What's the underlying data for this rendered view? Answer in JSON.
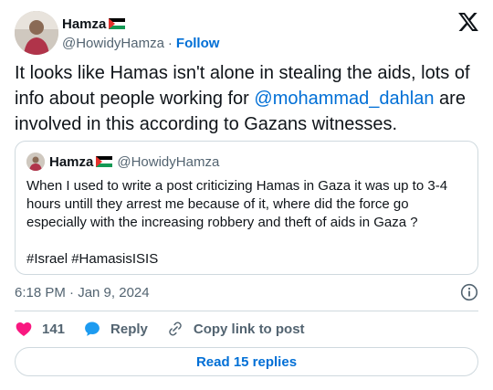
{
  "author": {
    "name": "Hamza",
    "handle": "@HowidyHamza",
    "separator": "·",
    "follow_label": "Follow"
  },
  "tweet": {
    "text_before": "It looks like Hamas isn't alone in stealing the aids, lots of info about people working for ",
    "mention": "@mohammad_dahlan",
    "text_after": " are involved in this according to Gazans witnesses."
  },
  "quote": {
    "name": "Hamza",
    "handle": "@HowidyHamza",
    "text": "When I used to write a post criticizing Hamas in Gaza it was up to 3-4 hours untill they arrest me because of it, where did the force go especially with the increasing robbery and theft of aids in Gaza ?",
    "tags": "#Israel #HamasisISIS"
  },
  "meta": {
    "timestamp": "6:18 PM · Jan 9, 2024"
  },
  "actions": {
    "like_count": "141",
    "reply_label": "Reply",
    "copy_label": "Copy link to post"
  },
  "read_replies_label": "Read 15 replies",
  "icons": {
    "logo": "x-logo-icon",
    "like": "heart-icon",
    "reply": "reply-bubble-icon",
    "copy": "link-icon",
    "info": "info-icon",
    "flag": "palestine-flag-icon"
  },
  "colors": {
    "link": "#006fd6",
    "heart": "#f91880",
    "reply_blue": "#1d9bf0",
    "muted": "#536471",
    "border": "#cfd9de"
  }
}
